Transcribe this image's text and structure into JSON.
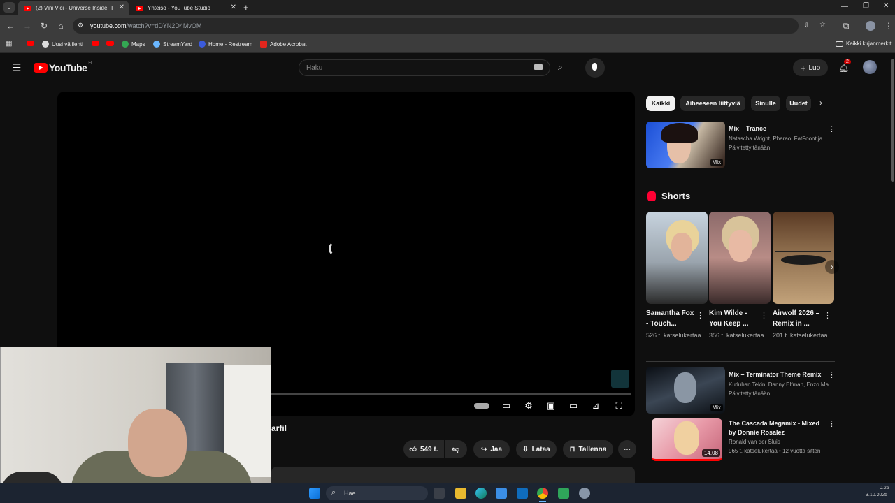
{
  "browser": {
    "tabs": [
      {
        "title": "(2) Vini Vici - Universe Inside. Th",
        "active": true
      },
      {
        "title": "Yhteisö - YouTube Studio",
        "active": false
      }
    ],
    "new_tab_label": "+",
    "url_host": "youtube.com",
    "url_path": "/watch?v=dDYN2D4MvOM",
    "bookmarks": [
      {
        "label": "",
        "icon": "youtube-icon"
      },
      {
        "label": "Uusi välilehti",
        "icon": "globe-icon"
      },
      {
        "label": "",
        "icon": "youtube-icon"
      },
      {
        "label": "",
        "icon": "youtube-icon"
      },
      {
        "label": "Maps",
        "icon": "maps-icon"
      },
      {
        "label": "StreamYard",
        "icon": "streamyard-icon"
      },
      {
        "label": "Home - Restream",
        "icon": "restream-icon"
      },
      {
        "label": "Adobe Acrobat",
        "icon": "acrobat-icon"
      }
    ],
    "all_bookmarks_label": "Kaikki kirjanmerkit"
  },
  "masthead": {
    "logo_text": "YouTube",
    "country_code": "FI",
    "search_placeholder": "Haku",
    "create_label": "Luo",
    "notification_count": "2"
  },
  "player": {
    "title_fragment": "arfil"
  },
  "actions": {
    "like_count": "549 t.",
    "share_label": "Jaa",
    "download_label": "Lataa",
    "save_label": "Tallenna"
  },
  "chips": [
    "Kaikki",
    "Aiheeseen liittyviä",
    "Sinulle",
    "Uudet"
  ],
  "mix_card": {
    "title": "Mix – Trance",
    "meta": "Natascha Wright, Pharao, FatFoont ja ...",
    "updated": "Päivitetty tänään",
    "badge": "Mix"
  },
  "shorts": {
    "heading": "Shorts",
    "items": [
      {
        "title": "Samantha Fox - Touch...",
        "views": "526 t. katselukertaa"
      },
      {
        "title": "Kim Wilde - You Keep ...",
        "views": "356 t. katselukertaa"
      },
      {
        "title": "Airwolf 2026 – Remix in ...",
        "views": "201 t. katselukertaa"
      }
    ]
  },
  "recs": [
    {
      "title": "Mix – Terminator Theme Remix",
      "meta": "Kutluhan Tekin, Danny Elfman, Enzo Ma...",
      "meta2": "Päivitetty tänään",
      "badge": "Mix"
    },
    {
      "title": "The Cascada Megamix - Mixed",
      "title2": "by Donnie Rosalez",
      "meta": "Ronald van der Sluis",
      "meta2": "965 t. katselukertaa • 12 vuotta sitten",
      "badge": "14.08"
    }
  ],
  "taskbar": {
    "search_placeholder": "Hae",
    "time": "0.25",
    "date": "3.10.2025"
  }
}
